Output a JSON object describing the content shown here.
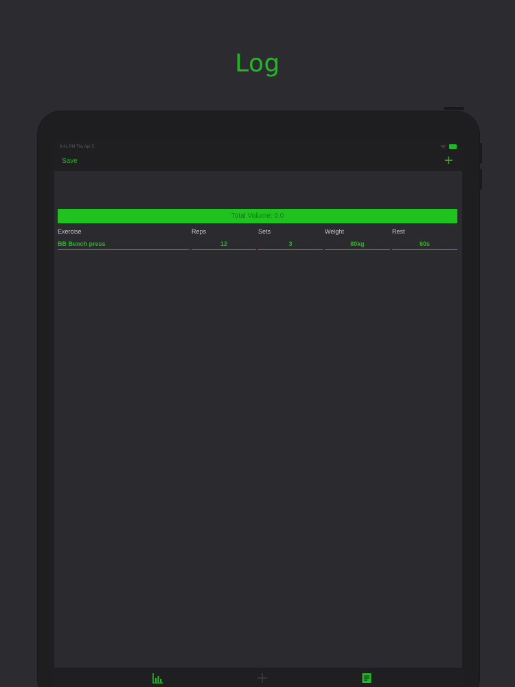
{
  "header": {
    "title": "Log"
  },
  "statusbar": {
    "time": "9:41 PM  Thu Apr 5"
  },
  "navbar": {
    "save_label": "Save",
    "add_label": "+"
  },
  "log": {
    "total_volume_label": "Total Volume: 0.0",
    "columns": [
      "Exercise",
      "Reps",
      "Sets",
      "Weight",
      "Rest"
    ],
    "rows": [
      {
        "exercise": "BB Bench press",
        "reps": "12",
        "sets": "3",
        "weight": "80kg",
        "rest": "60s"
      }
    ]
  },
  "tabbar": {
    "items": [
      {
        "icon": "bar-chart-icon",
        "active": true
      },
      {
        "icon": "plus-icon",
        "active": false
      },
      {
        "icon": "log-list-icon",
        "active": true
      }
    ]
  },
  "colors": {
    "accent": "#1fba1f",
    "background": "#2c2b2f",
    "bar": "#1f1f21"
  }
}
